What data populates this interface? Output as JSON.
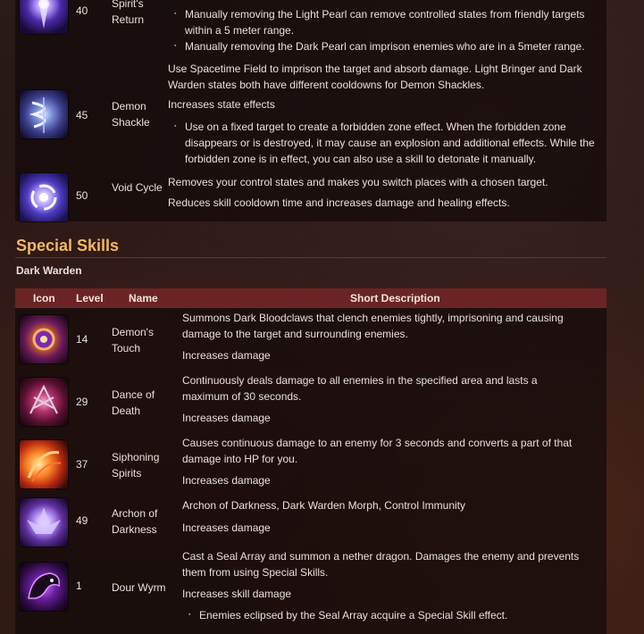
{
  "top_rows": [
    {
      "level": "40",
      "name": "Spirit's Return",
      "bullets": [
        "Manually removing the Light Pearl can remove controlled states from friendly targets within a 5 meter range.",
        "Manually removing the Dark Pearl can imprison enemies who are in a 5meter range."
      ]
    },
    {
      "level": "45",
      "name": "Demon Shackle",
      "desc": "Use Spacetime Field to imprison the target and absorb damage. Light Bringer and Dark Warden states both have different cooldowns for Demon Shackles.",
      "effect": "Increases state effects",
      "bullets": [
        "Use on a fixed target to create a forbidden zone effect. When the forbidden zone disappears or is destroyed, it may cause an explosion and additional effects. While the forbidden zone is in effect, you can also use a skill to detonate it manually."
      ]
    },
    {
      "level": "50",
      "name": "Void Cycle",
      "desc": "Removes your control states and makes you switch places with a chosen target.",
      "effect": "Reduces skill cooldown time and increases damage and healing effects."
    }
  ],
  "section_title": "Special Skills",
  "sub_title": "Dark Warden",
  "headers": {
    "icon": "Icon",
    "level": "Level",
    "name": "Name",
    "desc": "Short Description"
  },
  "special_rows": [
    {
      "level": "14",
      "name": "Demon's Touch",
      "desc": "Summons Dark Bloodclaws that clench enemies tightly, imprisoning and causing damage to the target and surrounding enemies.",
      "effect": "Increases damage"
    },
    {
      "level": "29",
      "name": "Dance of Death",
      "desc": "Continuously deals damage to all enemies in the specified area and lasts a maximum of 30 seconds.",
      "effect": "Increases damage"
    },
    {
      "level": "37",
      "name": "Siphoning Spirits",
      "desc": "Causes continuous damage to an enemy for 3 seconds and converts a part of that damage into HP for you.",
      "effect": "Increases damage"
    },
    {
      "level": "49",
      "name": "Archon of Darkness",
      "desc": "Archon of Darkness, Dark Warden Morph, Control Immunity",
      "effect": "Increases damage"
    },
    {
      "level": "1",
      "name": "Dour Wyrm",
      "desc": "Cast a Seal Array and summon a nether dragon. Damages the enemy and prevents them from using Special Skills.",
      "effect": "Increases skill damage",
      "bullets": [
        "Enemies eclipsed by the Seal Array acquire a Special Skill effect."
      ]
    }
  ],
  "icons": [
    "spirit-return-icon",
    "demon-shackle-icon",
    "void-cycle-icon",
    "demons-touch-icon",
    "dance-of-death-icon",
    "siphoning-spirits-icon",
    "archon-of-darkness-icon",
    "dour-wyrm-icon"
  ]
}
